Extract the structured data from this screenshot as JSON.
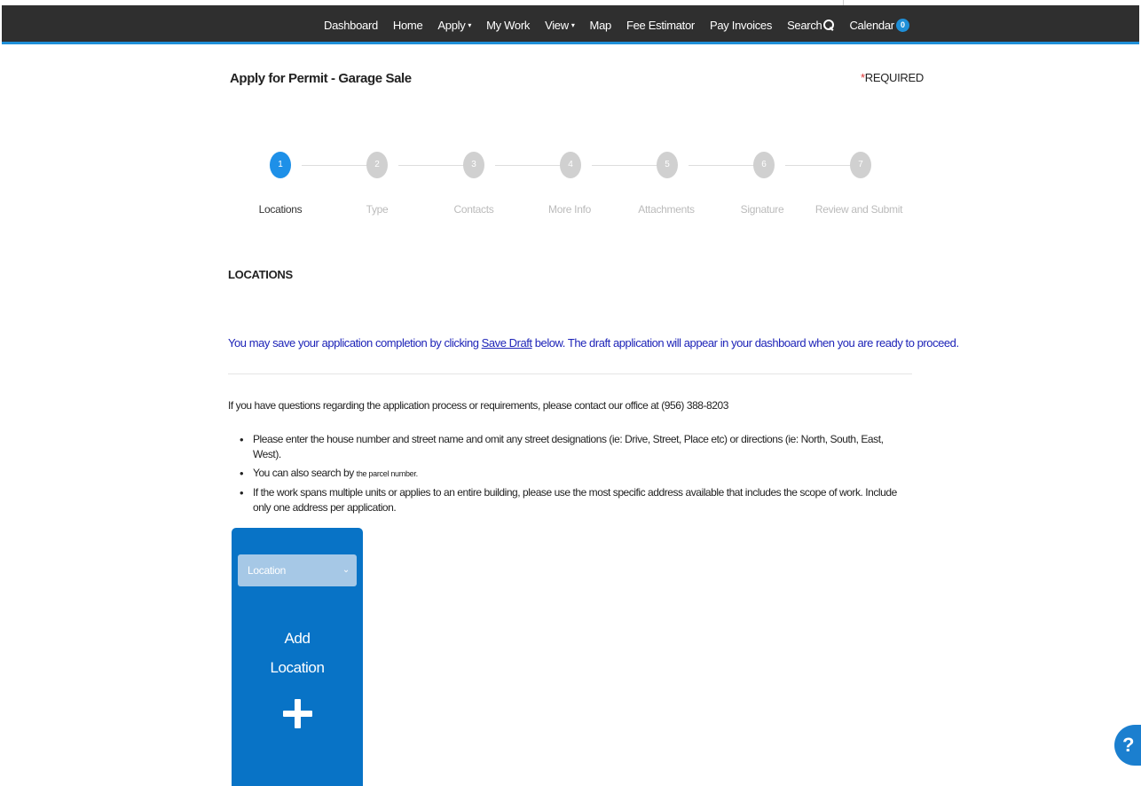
{
  "nav": {
    "items": [
      {
        "label": "Dashboard"
      },
      {
        "label": "Home"
      },
      {
        "label": "Apply",
        "caret": "▾"
      },
      {
        "label": "My Work"
      },
      {
        "label": "View",
        "caret": "▾"
      },
      {
        "label": "Map"
      },
      {
        "label": "Fee Estimator"
      },
      {
        "label": "Pay Invoices"
      },
      {
        "label": "Search"
      },
      {
        "label": "Calendar"
      }
    ],
    "calendar_count": "0"
  },
  "page": {
    "title": "Apply for Permit - Garage Sale",
    "required_star": "*",
    "required_label": "REQUIRED"
  },
  "steps": [
    {
      "number": "1",
      "label": "Locations",
      "active": true
    },
    {
      "number": "2",
      "label": "Type",
      "active": false
    },
    {
      "number": "3",
      "label": "Contacts",
      "active": false
    },
    {
      "number": "4",
      "label": "More Info",
      "active": false
    },
    {
      "number": "5",
      "label": "Attachments",
      "active": false
    },
    {
      "number": "6",
      "label": "Signature",
      "active": false
    },
    {
      "number": "7",
      "label": "Review and Submit",
      "active": false
    }
  ],
  "section": {
    "heading": "LOCATIONS",
    "draft_before": "You may save your application completion by clicking ",
    "draft_link": "Save Draft",
    "draft_after": " below.  The draft application will appear in your dashboard when you are ready to proceed.",
    "contact": "If you have questions regarding the application process or requirements, please contact our office at (956) 388-8203",
    "bullet1": "Please enter the house number and street name and omit any street designations (ie: Drive, Street, Place etc) or directions (ie: North, South, East, West).",
    "bullet2_main": "You can also search by ",
    "bullet2_small": "the parcel number.",
    "bullet3": "If the work spans multiple units or applies to an entire building, please use the most specific address available that includes the scope of work.  Include only one address per application."
  },
  "add_location": {
    "select_value": "Location",
    "title_line1": "Add",
    "title_line2": "Location"
  },
  "help": {
    "label": "?"
  },
  "colors": {
    "navbar": "#2f2f2f",
    "accent": "#1f8fd8",
    "card": "#0873c6",
    "draft_text": "#1e24b8"
  }
}
